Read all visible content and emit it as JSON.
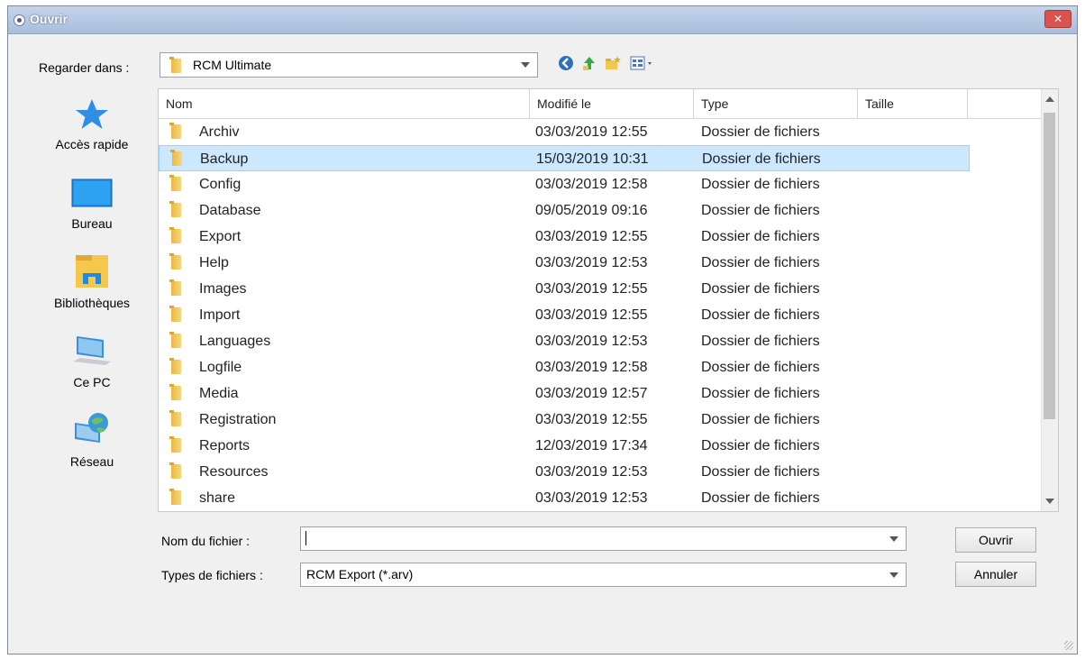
{
  "dialog": {
    "title": "Ouvrir"
  },
  "lookin": {
    "label": "Regarder dans :",
    "value": "RCM Ultimate"
  },
  "sidebar": {
    "items": [
      {
        "label": "Accès rapide",
        "icon": "star-icon"
      },
      {
        "label": "Bureau",
        "icon": "desktop-icon"
      },
      {
        "label": "Bibliothèques",
        "icon": "library-icon"
      },
      {
        "label": "Ce PC",
        "icon": "computer-icon"
      },
      {
        "label": "Réseau",
        "icon": "network-icon"
      }
    ]
  },
  "columns": {
    "name": "Nom",
    "modified": "Modifié le",
    "type": "Type",
    "size": "Taille"
  },
  "rows": [
    {
      "name": "Archiv",
      "modified": "03/03/2019 12:55",
      "type": "Dossier de fichiers"
    },
    {
      "name": "Backup",
      "modified": "15/03/2019 10:31",
      "type": "Dossier de fichiers"
    },
    {
      "name": "Config",
      "modified": "03/03/2019 12:58",
      "type": "Dossier de fichiers"
    },
    {
      "name": "Database",
      "modified": "09/05/2019 09:16",
      "type": "Dossier de fichiers"
    },
    {
      "name": "Export",
      "modified": "03/03/2019 12:55",
      "type": "Dossier de fichiers"
    },
    {
      "name": "Help",
      "modified": "03/03/2019 12:53",
      "type": "Dossier de fichiers"
    },
    {
      "name": "Images",
      "modified": "03/03/2019 12:55",
      "type": "Dossier de fichiers"
    },
    {
      "name": "Import",
      "modified": "03/03/2019 12:55",
      "type": "Dossier de fichiers"
    },
    {
      "name": "Languages",
      "modified": "03/03/2019 12:53",
      "type": "Dossier de fichiers"
    },
    {
      "name": "Logfile",
      "modified": "03/03/2019 12:58",
      "type": "Dossier de fichiers"
    },
    {
      "name": "Media",
      "modified": "03/03/2019 12:57",
      "type": "Dossier de fichiers"
    },
    {
      "name": "Registration",
      "modified": "03/03/2019 12:55",
      "type": "Dossier de fichiers"
    },
    {
      "name": "Reports",
      "modified": "12/03/2019 17:34",
      "type": "Dossier de fichiers"
    },
    {
      "name": "Resources",
      "modified": "03/03/2019 12:53",
      "type": "Dossier de fichiers"
    },
    {
      "name": "share",
      "modified": "03/03/2019 12:53",
      "type": "Dossier de fichiers"
    }
  ],
  "selected_row": "Backup",
  "filename": {
    "label": "Nom du fichier :",
    "value": ""
  },
  "filetype": {
    "label": "Types de fichiers :",
    "value": "RCM Export (*.arv)"
  },
  "buttons": {
    "open": "Ouvrir",
    "cancel": "Annuler"
  },
  "colors": {
    "selection": "#cce8ff",
    "selection_border": "#99d1ff",
    "titlebar": "#b7c9e2",
    "close": "#d9534f"
  }
}
